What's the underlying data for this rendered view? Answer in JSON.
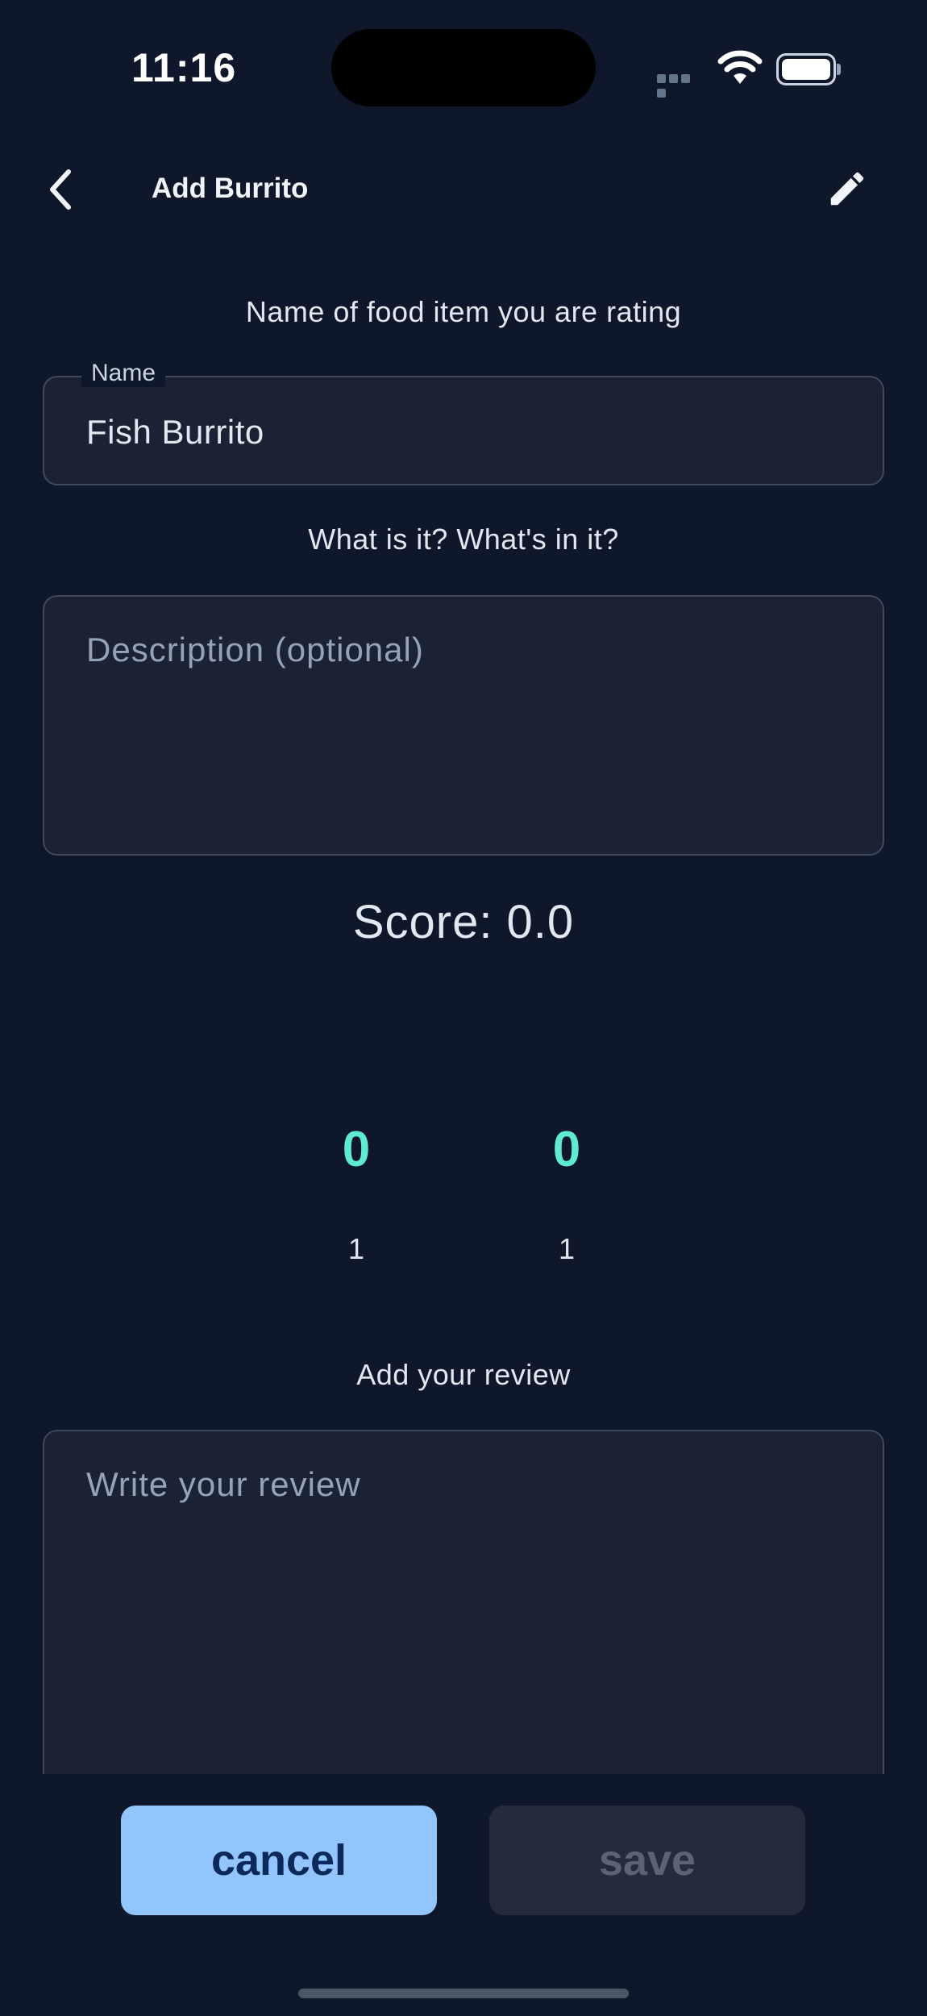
{
  "status_bar": {
    "time": "11:16"
  },
  "appbar": {
    "title": "Add Burrito",
    "back_icon": "chevron-left-icon",
    "edit_icon": "pencil-icon"
  },
  "form": {
    "name_caption": "Name of food item you are rating",
    "name_label": "Name",
    "name_value": "Fish Burrito",
    "description_caption": "What is it? What's in it?",
    "description_placeholder": "Description (optional)",
    "score_text": "Score: 0.0",
    "pickers": [
      {
        "value": "0",
        "label": "1"
      },
      {
        "value": "0",
        "label": "1"
      }
    ],
    "review_caption": "Add your review",
    "review_placeholder": "Write your review"
  },
  "actions": {
    "cancel_label": "cancel",
    "save_label": "save"
  },
  "colors": {
    "background": "#0f172a",
    "accent": "#5eead4",
    "cancel_button": "#93c5fd",
    "save_button_disabled": "#252b3b"
  }
}
